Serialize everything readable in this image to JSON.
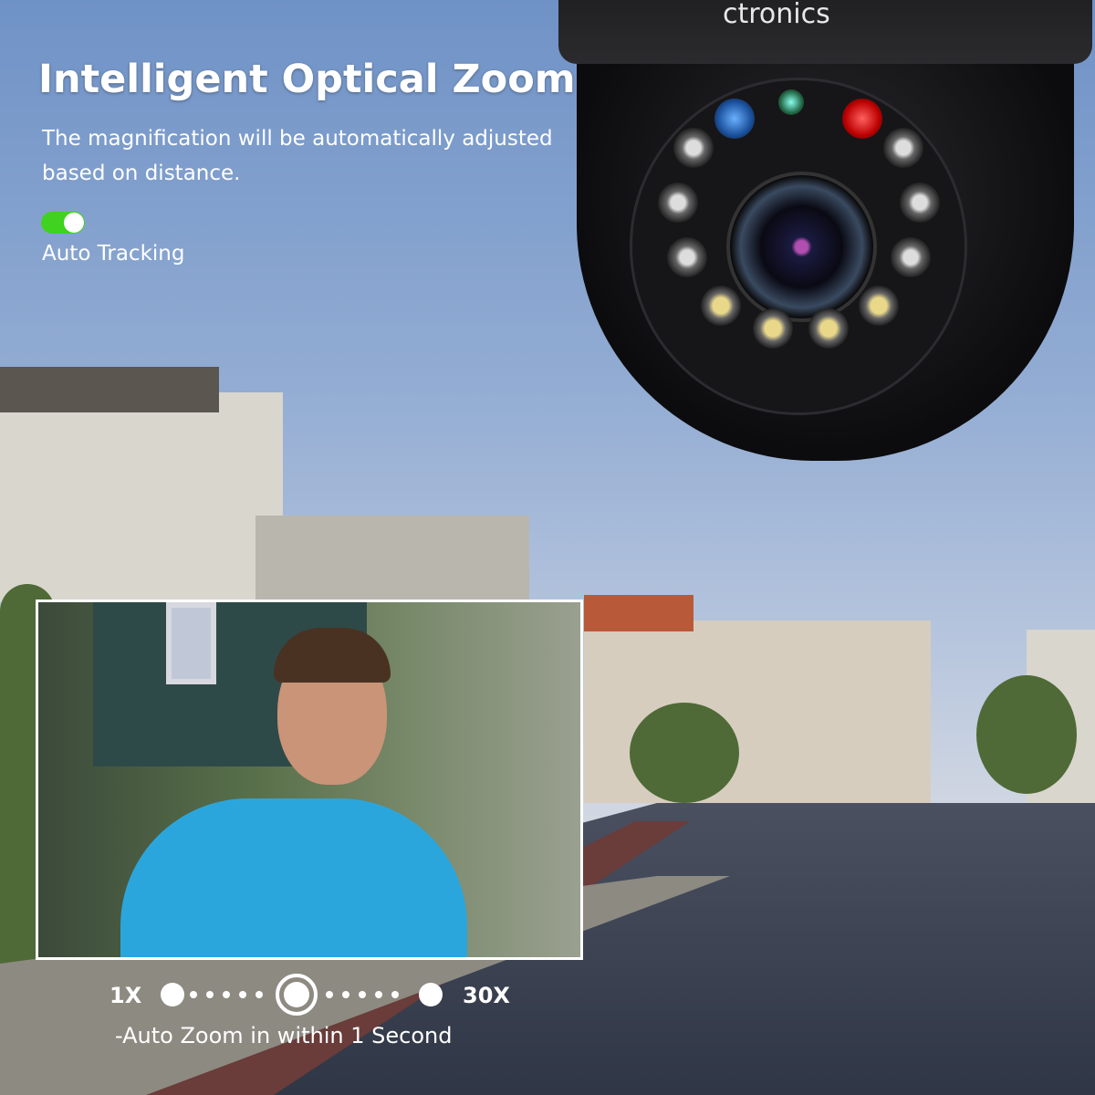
{
  "headline": "Intelligent Optical Zoom",
  "subtitle": "The magnification will be automatically adjusted based on distance.",
  "toggle": {
    "label": "Auto Tracking",
    "state": "on",
    "color": "#3fd21f"
  },
  "brand_logo": "ctronics",
  "zoom_slider": {
    "min_label": "1X",
    "max_label": "30X",
    "level_fraction": 0.5
  },
  "caption": "-Auto Zoom in within 1 Second"
}
